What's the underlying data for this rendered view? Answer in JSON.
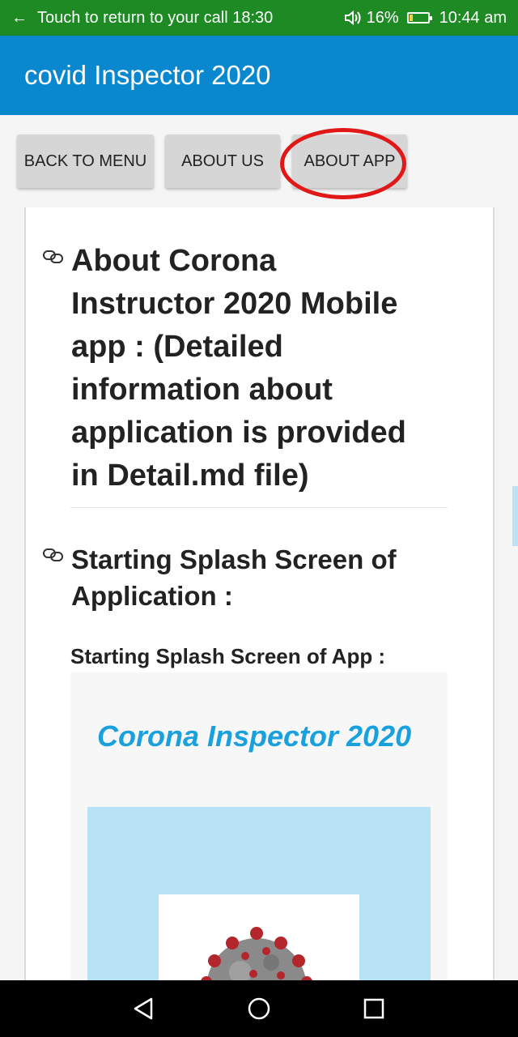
{
  "status_bar": {
    "call_text": "Touch to return to your call 18:30",
    "battery": "16%",
    "time": "10:44 am",
    "back_icon": "arrow-left-icon",
    "volume_icon": "volume-icon",
    "battery_icon": "battery-icon",
    "color": "#1d8a24"
  },
  "app_bar": {
    "title": "covid Inspector 2020",
    "color": "#0a88cf"
  },
  "buttons": {
    "back_to_menu": "BACK TO MENU",
    "about_us": "ABOUT US",
    "about_app": "ABOUT APP",
    "highlight_color": "#e01818"
  },
  "content": {
    "heading1": "About Corona Instructor 2020 Mobile app : (Detailed information about application is provided in Detail.md file)",
    "heading2": "Starting Splash Screen of Application :",
    "subheading": "Starting Splash Screen of App :",
    "splash_title": "Corona Inspector 2020",
    "link_icon": "link-icon"
  },
  "system_nav": {
    "back_icon": "triangle-back-icon",
    "home_icon": "circle-home-icon",
    "recents_icon": "square-recents-icon"
  }
}
